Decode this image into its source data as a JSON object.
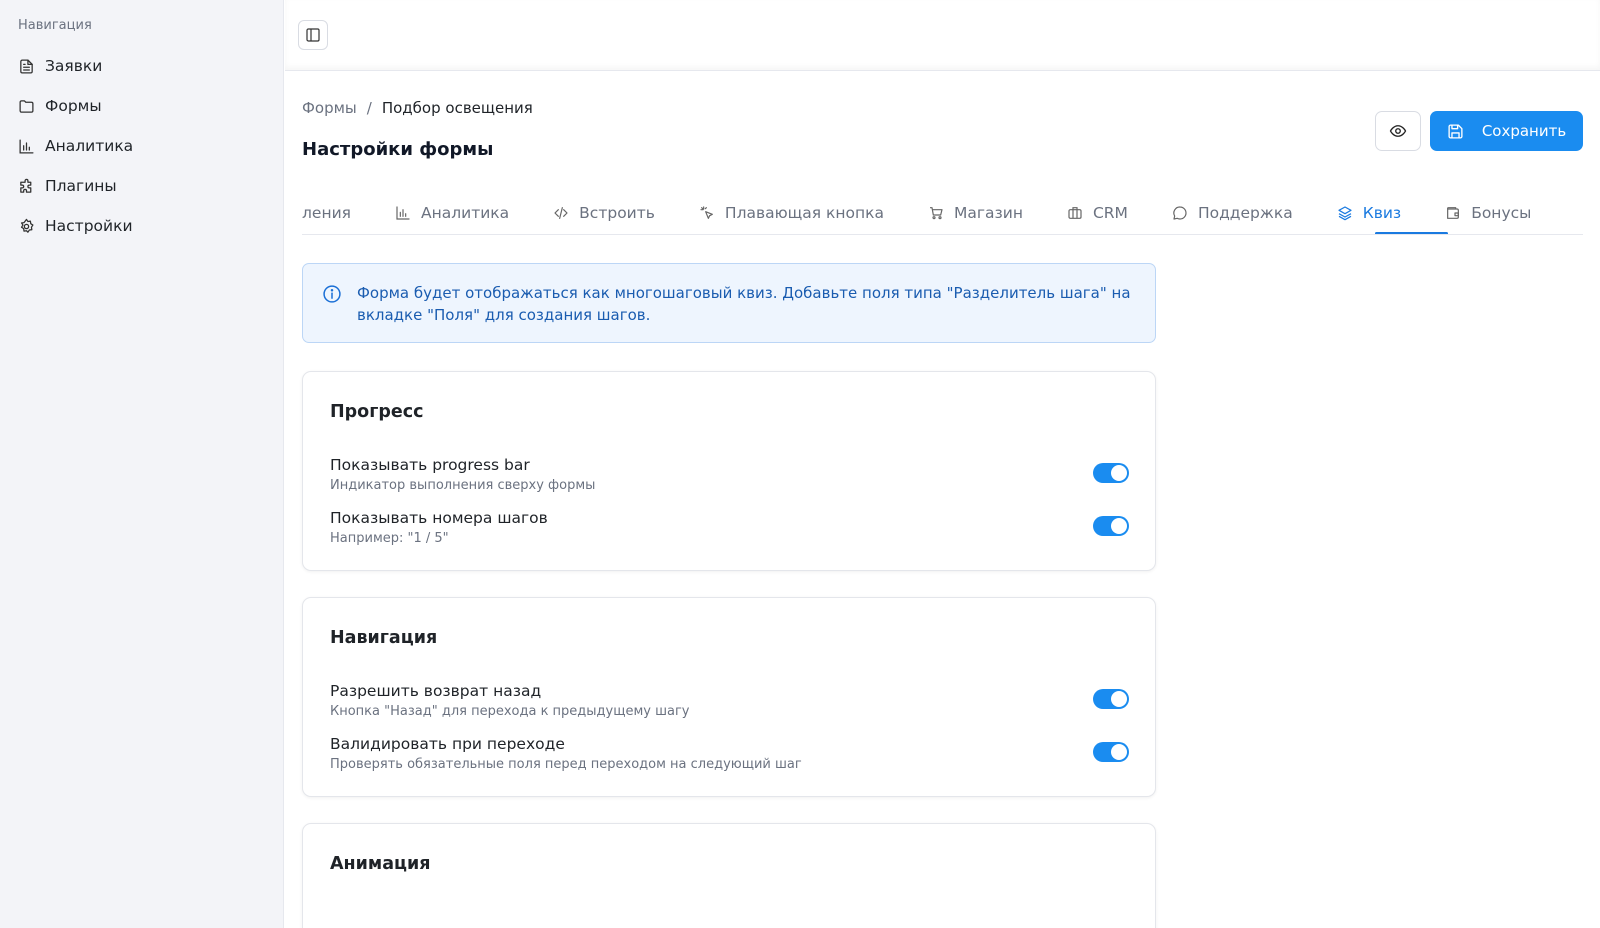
{
  "sidebar": {
    "title": "Навигация",
    "items": [
      {
        "label": "Заявки",
        "icon": "file-text-icon"
      },
      {
        "label": "Формы",
        "icon": "folder-icon"
      },
      {
        "label": "Аналитика",
        "icon": "bar-chart-icon"
      },
      {
        "label": "Плагины",
        "icon": "puzzle-icon"
      },
      {
        "label": "Настройки",
        "icon": "gear-icon"
      }
    ]
  },
  "breadcrumb": {
    "parent": "Формы",
    "separator": "/",
    "current": "Подбор освещения"
  },
  "page_title": "Настройки формы",
  "actions": {
    "save_label": "Сохранить",
    "preview_icon": "eye-icon"
  },
  "tabs": [
    {
      "label": "Уведомления",
      "icon": "bell-icon"
    },
    {
      "label": "Аналитика",
      "icon": "bar-chart-icon"
    },
    {
      "label": "Встроить",
      "icon": "code-icon"
    },
    {
      "label": "Плавающая кнопка",
      "icon": "pointer-click-icon"
    },
    {
      "label": "Магазин",
      "icon": "cart-icon"
    },
    {
      "label": "CRM",
      "icon": "briefcase-icon"
    },
    {
      "label": "Поддержка",
      "icon": "chat-icon"
    },
    {
      "label": "Квиз",
      "icon": "layers-icon",
      "active": true
    },
    {
      "label": "Бонусы",
      "icon": "wallet-icon"
    }
  ],
  "alert": {
    "text": "Форма будет отображаться как многошаговый квиз. Добавьте поля типа \"Разделитель шага\" на вкладке \"Поля\" для создания шагов.",
    "icon": "info-icon"
  },
  "sections": {
    "progress": {
      "title": "Прогресс",
      "rows": [
        {
          "label": "Показывать progress bar",
          "desc": "Индикатор выполнения сверху формы",
          "enabled": true
        },
        {
          "label": "Показывать номера шагов",
          "desc": "Например: \"1 / 5\"",
          "enabled": true
        }
      ]
    },
    "navigation": {
      "title": "Навигация",
      "rows": [
        {
          "label": "Разрешить возврат назад",
          "desc": "Кнопка \"Назад\" для перехода к предыдущему шагу",
          "enabled": true
        },
        {
          "label": "Валидировать при переходе",
          "desc": "Проверять обязательные поля перед переходом на следующий шаг",
          "enabled": true
        }
      ]
    },
    "animation": {
      "title": "Анимация"
    }
  },
  "colors": {
    "accent": "#1a8cf0",
    "active_tab": "#1a7ae0",
    "alert_text": "#1a5cb0"
  }
}
